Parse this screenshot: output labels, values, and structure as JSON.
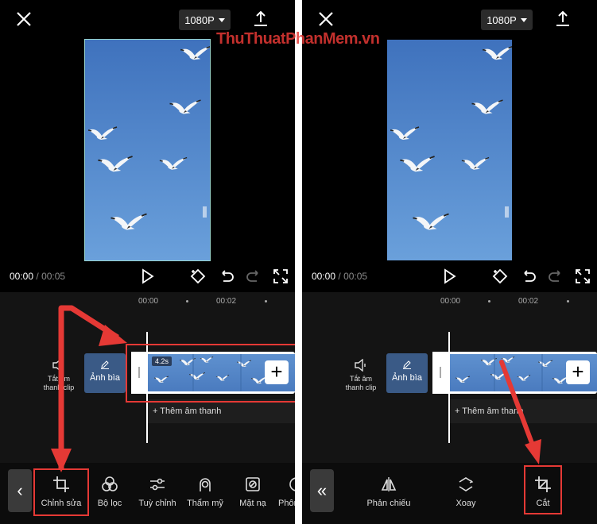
{
  "resolution": "1080P",
  "watermark": "ThuThuatPhanMem.vn",
  "time": {
    "current": "00:00",
    "separator": "/",
    "duration": "00:05"
  },
  "ruler": [
    "00:00",
    "00:02"
  ],
  "timeline": {
    "mute_line1": "Tắt âm",
    "mute_line2": "thanh clip",
    "cover_label": "Ảnh bìa",
    "clip_duration": "4.2s",
    "add_audio": "+ Thêm âm thanh",
    "add_clip": "+"
  },
  "left_toolbar": {
    "back": "‹",
    "items": [
      "Chỉnh sửa",
      "Bộ lọc",
      "Tuỳ chỉnh",
      "Thẩm mỹ",
      "Mặt nạ",
      "Phông"
    ]
  },
  "right_toolbar": {
    "back": "«",
    "items": [
      "Phản chiếu",
      "Xoay",
      "Cắt"
    ]
  },
  "colors": {
    "highlight": "#e53935",
    "cover_bg": "#3a5a86",
    "sky": "#4a7bbf"
  },
  "icons": [
    "close-icon",
    "export-icon",
    "play-icon",
    "keyframe-icon",
    "undo-icon",
    "redo-icon",
    "fullscreen-icon",
    "speaker-icon",
    "pencil-icon",
    "crop-icon",
    "filter-icon",
    "adjust-icon",
    "beauty-icon",
    "mask-icon",
    "mirror-icon",
    "rotate-icon"
  ]
}
